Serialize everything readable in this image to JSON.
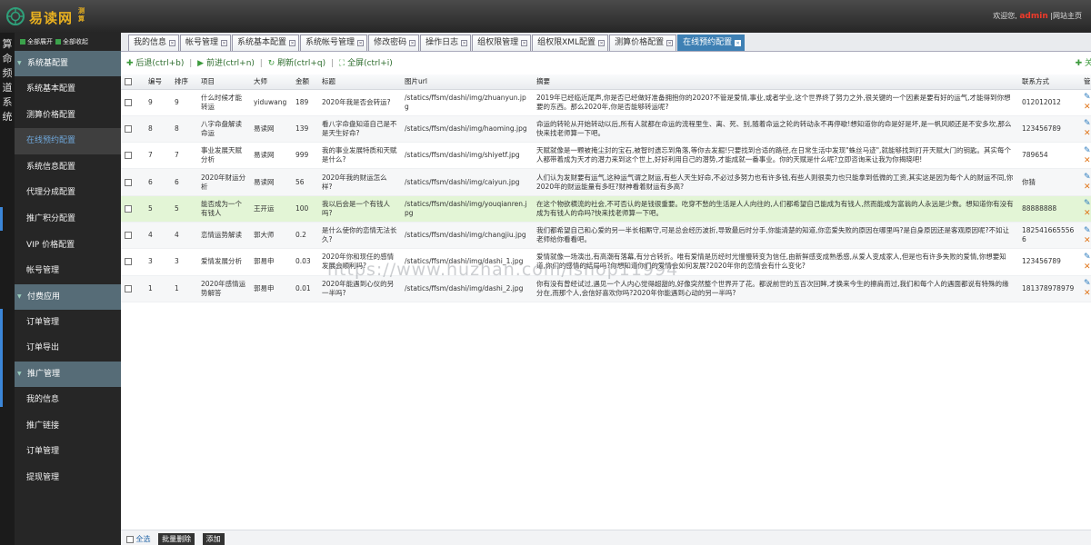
{
  "app": {
    "logo_text": "易读网",
    "logo_sub": "测算",
    "greeting": "欢迎您,",
    "username": "admin",
    "portal_link": "网站主页",
    "system_name": "算命频道系统"
  },
  "sidebar": {
    "expand_all": "全部展开",
    "collapse_all": "全部收起",
    "groups": [
      {
        "title": "系统基配置",
        "items": [
          "系统基本配置",
          "测算价格配置",
          "在线预约配置",
          "系统信息配置",
          "代理分成配置",
          "推广积分配置",
          "VIP 价格配置",
          "帐号管理"
        ]
      },
      {
        "title": "付费应用",
        "items": [
          "订单管理",
          "订单导出"
        ]
      },
      {
        "title": "推广管理",
        "items": [
          "我的信息",
          "推广链接",
          "订单管理",
          "提现管理"
        ]
      }
    ],
    "active_item": "在线预约配置"
  },
  "tabs": [
    "我的信息",
    "帐号管理",
    "系统基本配置",
    "系统帐号管理",
    "修改密码",
    "操作日志",
    "组权限管理",
    "组权限XML配置",
    "测算价格配置",
    "在线预约配置"
  ],
  "active_tab": "在线预约配置",
  "toolbar": {
    "back": "后退(ctrl+b)",
    "forward": "前进(ctrl+n)",
    "refresh": "刷新(ctrl+q)",
    "fullscreen": "全屏(ctrl+i)",
    "close": "关"
  },
  "table": {
    "columns": [
      "编号",
      "排序",
      "项目",
      "大师",
      "金额",
      "标题",
      "图片url",
      "摘要",
      "联系方式",
      "管"
    ],
    "rows": [
      {
        "id": "9",
        "sort": "9",
        "project": "什么时候才能转运",
        "master": "yiduwang",
        "amount": "189",
        "title": "2020年我是否会转运?",
        "img": "/statics/ffsm/dashi/img/zhuanyun.jpg",
        "summary": "2019年已经临近尾声,你是否已经做好准备拥抱你的2020?不管是爱情,事业,或者学业,这个世界终了努力之外,很关键的一个因素是要有好的运气,才能得到你想要的东西。那么2020年,你是否能够转运呢?",
        "contact": "012012012"
      },
      {
        "id": "8",
        "sort": "8",
        "project": "八字命盘解读命运",
        "master": "易读网",
        "amount": "139",
        "title": "看八字命盘知道自己是不是天生好命?",
        "img": "/statics/ffsm/dashi/img/haoming.jpg",
        "summary": "命运的转轮从开始转动以后,所有人就都在命运的流程里生、离、死、别,随着命运之轮的转动永不再停歇!想知道你的命是好是坏,是一帆风顺还是不安多坎,那么快来找老师算一下吧。",
        "contact": "123456789"
      },
      {
        "id": "7",
        "sort": "7",
        "project": "事业发展天赋分析",
        "master": "易读网",
        "amount": "999",
        "title": "我的事业发展特质和天赋是什么?",
        "img": "/statics/ffsm/dashi/img/shiyetf.jpg",
        "summary": "天赋就像是一颗被掩尘封的宝石,被智时遗忘到角落,等你去发掘!只要找到合适的路径,在日常生活中发现\"蛛丝马迹\",就能够找到打开天赋大门的钥匙。其实每个人都带着成为天才的潜力来到这个世上,好好利用自己的潜势,才能成就一番事业。你的天赋是什么呢?立即咨询来让我为你揭晓吧!",
        "contact": "789654"
      },
      {
        "id": "6",
        "sort": "6",
        "project": "2020年财运分析",
        "master": "易读网",
        "amount": "56",
        "title": "2020年我的财运怎么样?",
        "img": "/statics/ffsm/dashi/img/caiyun.jpg",
        "summary": "人们认为发财要有运气,这种运气谓之财运,有些人天生好命,不必过多努力也有许多钱,有些人则很卖力也只能拿到低微的工资,其实这是因为每个人的财运不同,你2020年的财运能量有多旺?财神看着财运有多高?",
        "contact": "你猜"
      },
      {
        "id": "5",
        "sort": "5",
        "project": "能否成为一个有钱人",
        "master": "王开运",
        "amount": "100",
        "title": "我以后会是一个有钱人吗?",
        "img": "/statics/ffsm/dashi/img/youqianren.jpg",
        "summary": "在这个物欲横流的社会,不可否认的是钱很重要。吃穿不愁的生活是人人向往的,人们都希望自己能成为有钱人,然而能成为富翁的人永远是少数。想知道你有没有成为有钱人的命吗?快来找老师算一下吧。",
        "contact": "88888888"
      },
      {
        "id": "4",
        "sort": "4",
        "project": "恋情运势解读",
        "master": "郭大师",
        "amount": "0.2",
        "title": "是什么使你的恋情无法长久?",
        "img": "/statics/ffsm/dashi/img/changjiu.jpg",
        "summary": "我们都希望自己和心爱的另一半长相厮守,可是总会经历波折,导致最后时分手,你能清楚的知道,你恋爱失败的原因在哪里吗?是自身原因还是客观原因呢?不如让老师给你看看吧。",
        "contact": "1825416655566"
      },
      {
        "id": "3",
        "sort": "3",
        "project": "爱情发展分析",
        "master": "郭易申",
        "amount": "0.03",
        "title": "2020年你和现任的感情发展会顺利吗?",
        "img": "/statics/ffsm/dashi/img/dashi_1.jpg",
        "summary": "爱情就像一场演出,有高潮有落幕,有分合转折。唯有爱情是历经时光慢慢转变为信任,由新鲜感变成熟悉感,从爱人变成家人,但是也有许多失败的爱情,你想要知道,你们的感情的结局吗?你想知道你们的爱情会如何发展?2020年你的恋情会有什么变化?",
        "contact": "123456789"
      },
      {
        "id": "1",
        "sort": "1",
        "project": "2020年感情运势解答",
        "master": "郭易申",
        "amount": "0.01",
        "title": "2020年能遇到心仪的另一半吗?",
        "img": "/statics/ffsm/dashi/img/dashi_2.jpg",
        "summary": "你有没有曾经试过,遇见一个人内心觉得超甜的,好像突然整个世界开了花。都说前世的五百次回眸,才换来今生的擦肩而过,我们和每个人的遇面都说有特殊的缘分在,而那个人,会信好喜欢你吗?2020年你能遇到心动的另一半吗?",
        "contact": "181378978979"
      }
    ]
  },
  "watermark": "https://www.huzhan.com/ishop11994",
  "footer": {
    "select_all": "全选",
    "batch_delete": "批量删除",
    "add": "添加"
  }
}
